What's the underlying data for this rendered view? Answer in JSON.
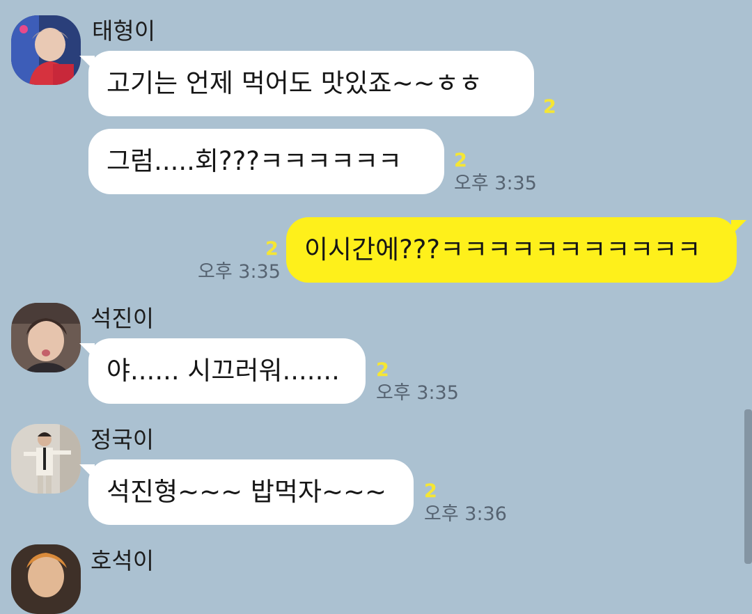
{
  "messages": [
    {
      "sender": "태형이",
      "text": "고기는 언제 먹어도 맛있죠~~ㅎㅎ",
      "unread": "2"
    },
    {
      "text": "그럼.....회???ㅋㅋㅋㅋㅋㅋ",
      "unread": "2",
      "time": "오후 3:35"
    },
    {
      "text": "이시간에???ㅋㅋㅋㅋㅋㅋㅋㅋㅋㅋㅋ",
      "unread": "2",
      "time": "오후 3:35",
      "mine": true
    },
    {
      "sender": "석진이",
      "text": "야...... 시끄러워.......",
      "unread": "2",
      "time": "오후 3:35"
    },
    {
      "sender": "정국이",
      "text": "석진형~~~ 밥먹자~~~",
      "unread": "2",
      "time": "오후 3:36"
    },
    {
      "sender": "호석이"
    }
  ],
  "colors": {
    "background": "#abc1d1",
    "incoming_bubble": "#ffffff",
    "outgoing_bubble": "#fef01b",
    "unread_count": "#f5e634",
    "timestamp": "#566371"
  }
}
